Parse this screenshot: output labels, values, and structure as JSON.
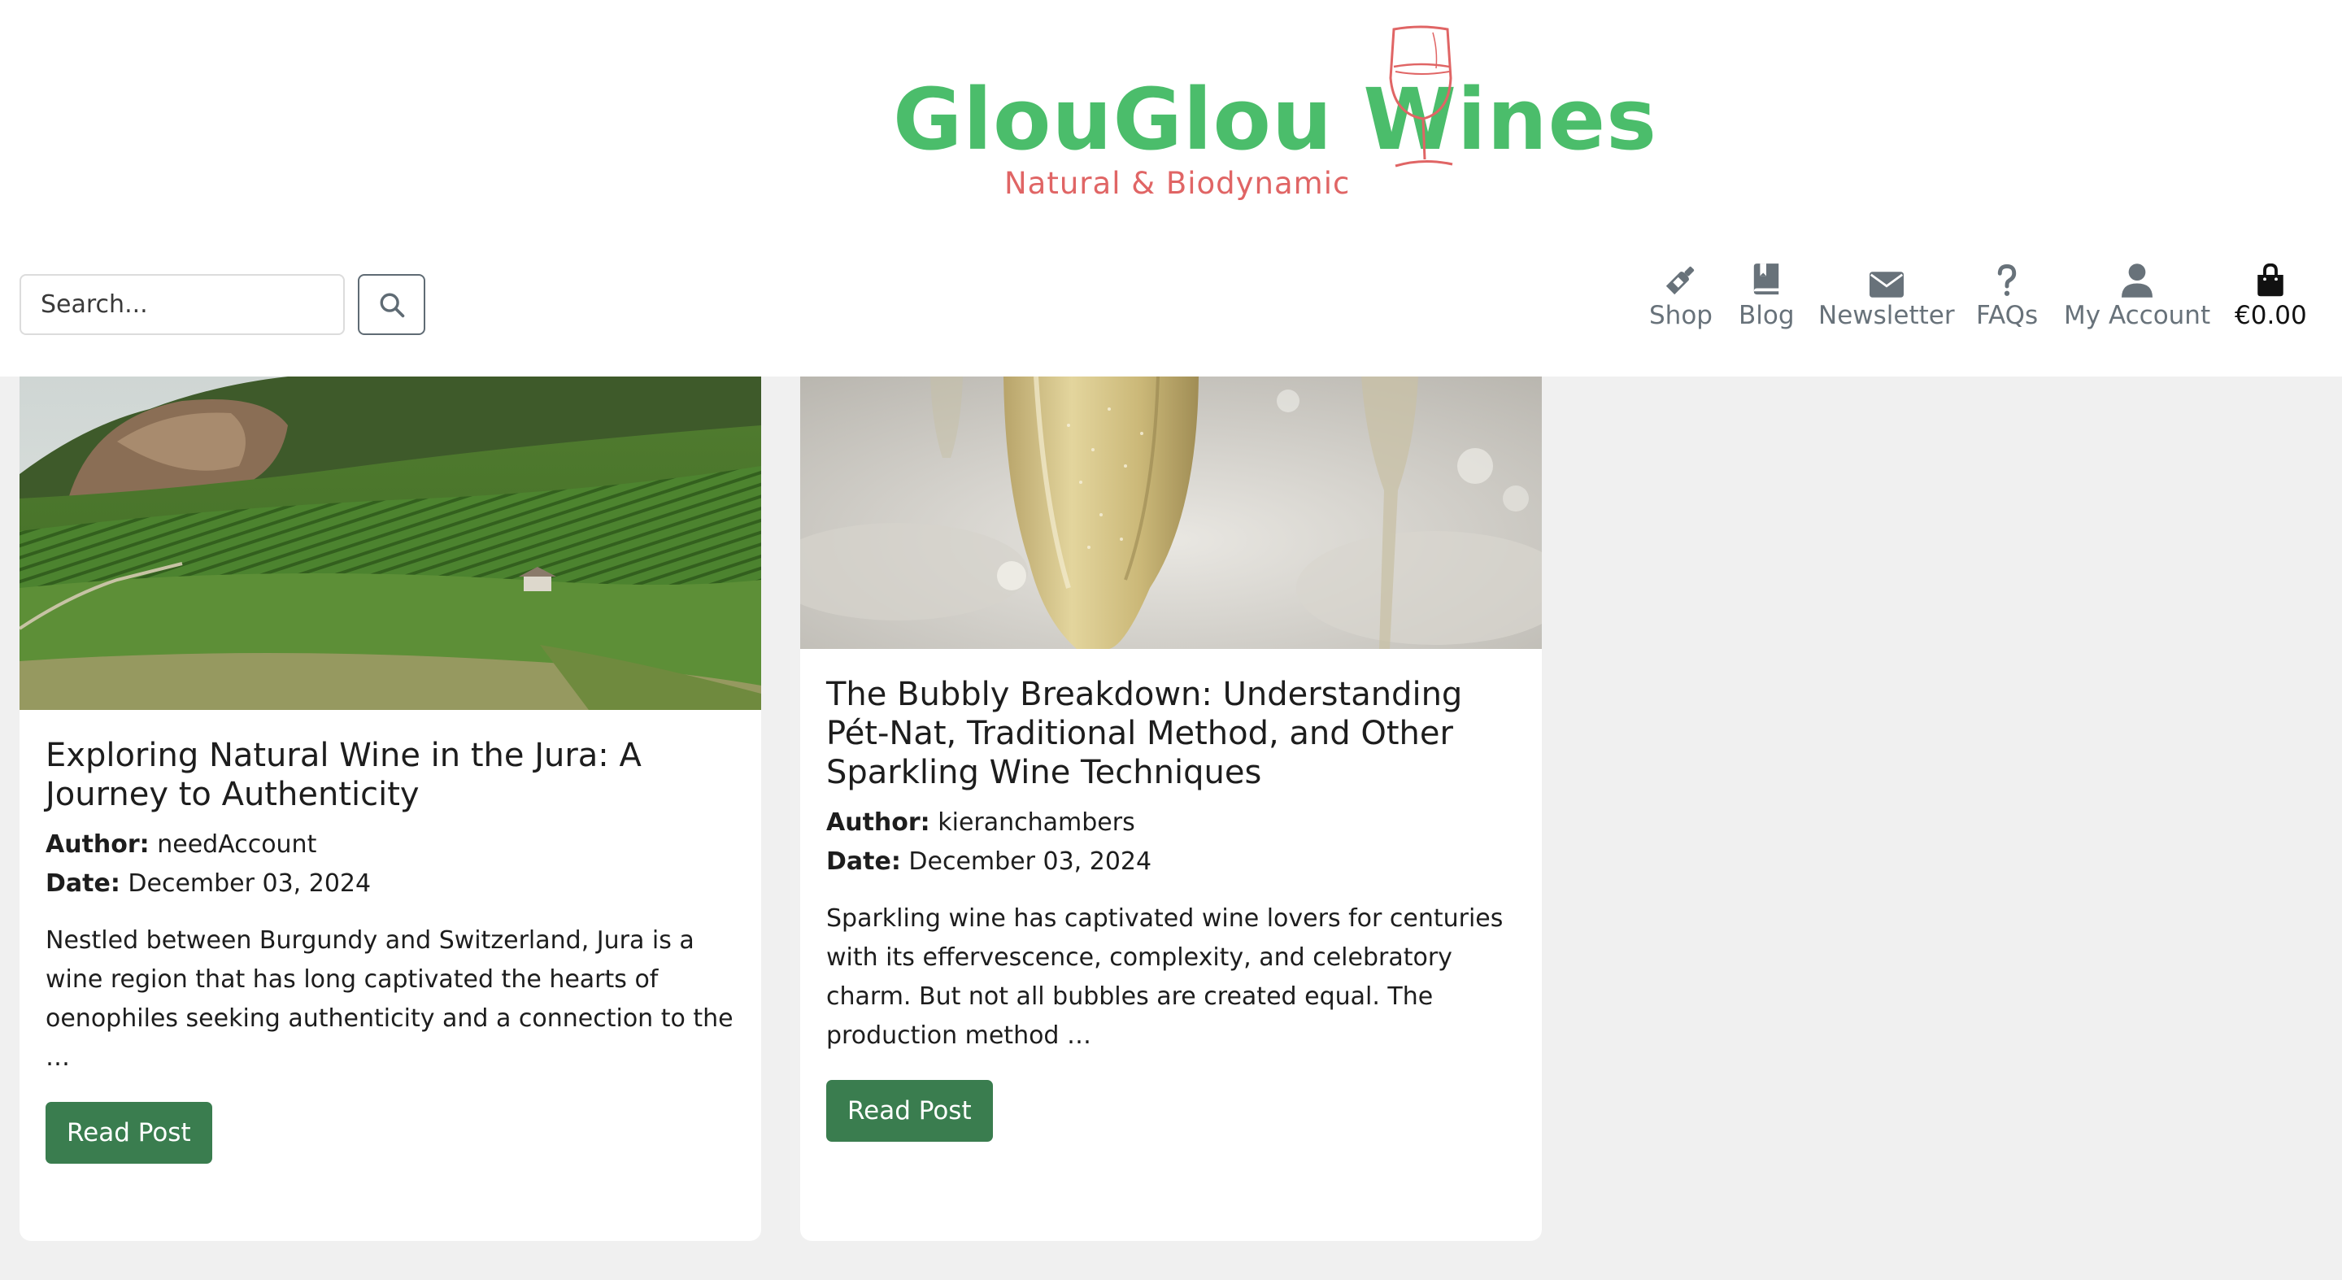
{
  "brand": {
    "title": "GlouGlou Wines",
    "subtitle": "Natural & Biodynamic",
    "title_color": "#4bbd6b",
    "subtitle_color": "#e06565"
  },
  "search": {
    "placeholder": "Search..."
  },
  "nav": {
    "items": [
      {
        "label": "Shop",
        "icon": "wine-bottle-icon"
      },
      {
        "label": "Blog",
        "icon": "book-icon"
      },
      {
        "label": "Newsletter",
        "icon": "envelope-icon"
      },
      {
        "label": "FAQs",
        "icon": "question-icon"
      },
      {
        "label": "My Account",
        "icon": "user-icon"
      }
    ],
    "cart_total": "€0.00",
    "cart_icon": "shopping-bag-icon"
  },
  "posts": [
    {
      "title": "Exploring Natural Wine in the Jura: A Journey to Authenticity",
      "author_label": "Author:",
      "author": "needAccount",
      "date_label": "Date:",
      "date": "December 03, 2024",
      "excerpt": "Nestled between Burgundy and Switzerland, Jura is a wine region that has long captivated the hearts of oenophiles seeking authenticity and a connection to the …",
      "button": "Read Post",
      "image": "vineyard-hillside-image"
    },
    {
      "title": "The Bubbly Breakdown: Understanding Pét-Nat, Traditional Method, and Other Sparkling Wine Techniques",
      "author_label": "Author:",
      "author": "kieranchambers",
      "date_label": "Date:",
      "date": "December 03, 2024",
      "excerpt": "Sparkling wine has captivated wine lovers for centuries with its effervescence, complexity, and celebratory charm. But not all bubbles are created equal. The production method …",
      "button": "Read Post",
      "image": "sparkling-wine-glass-image"
    }
  ],
  "colors": {
    "button_green": "#3a7d4f",
    "page_bg": "#f0f0f0",
    "nav_grey": "#68727a"
  }
}
